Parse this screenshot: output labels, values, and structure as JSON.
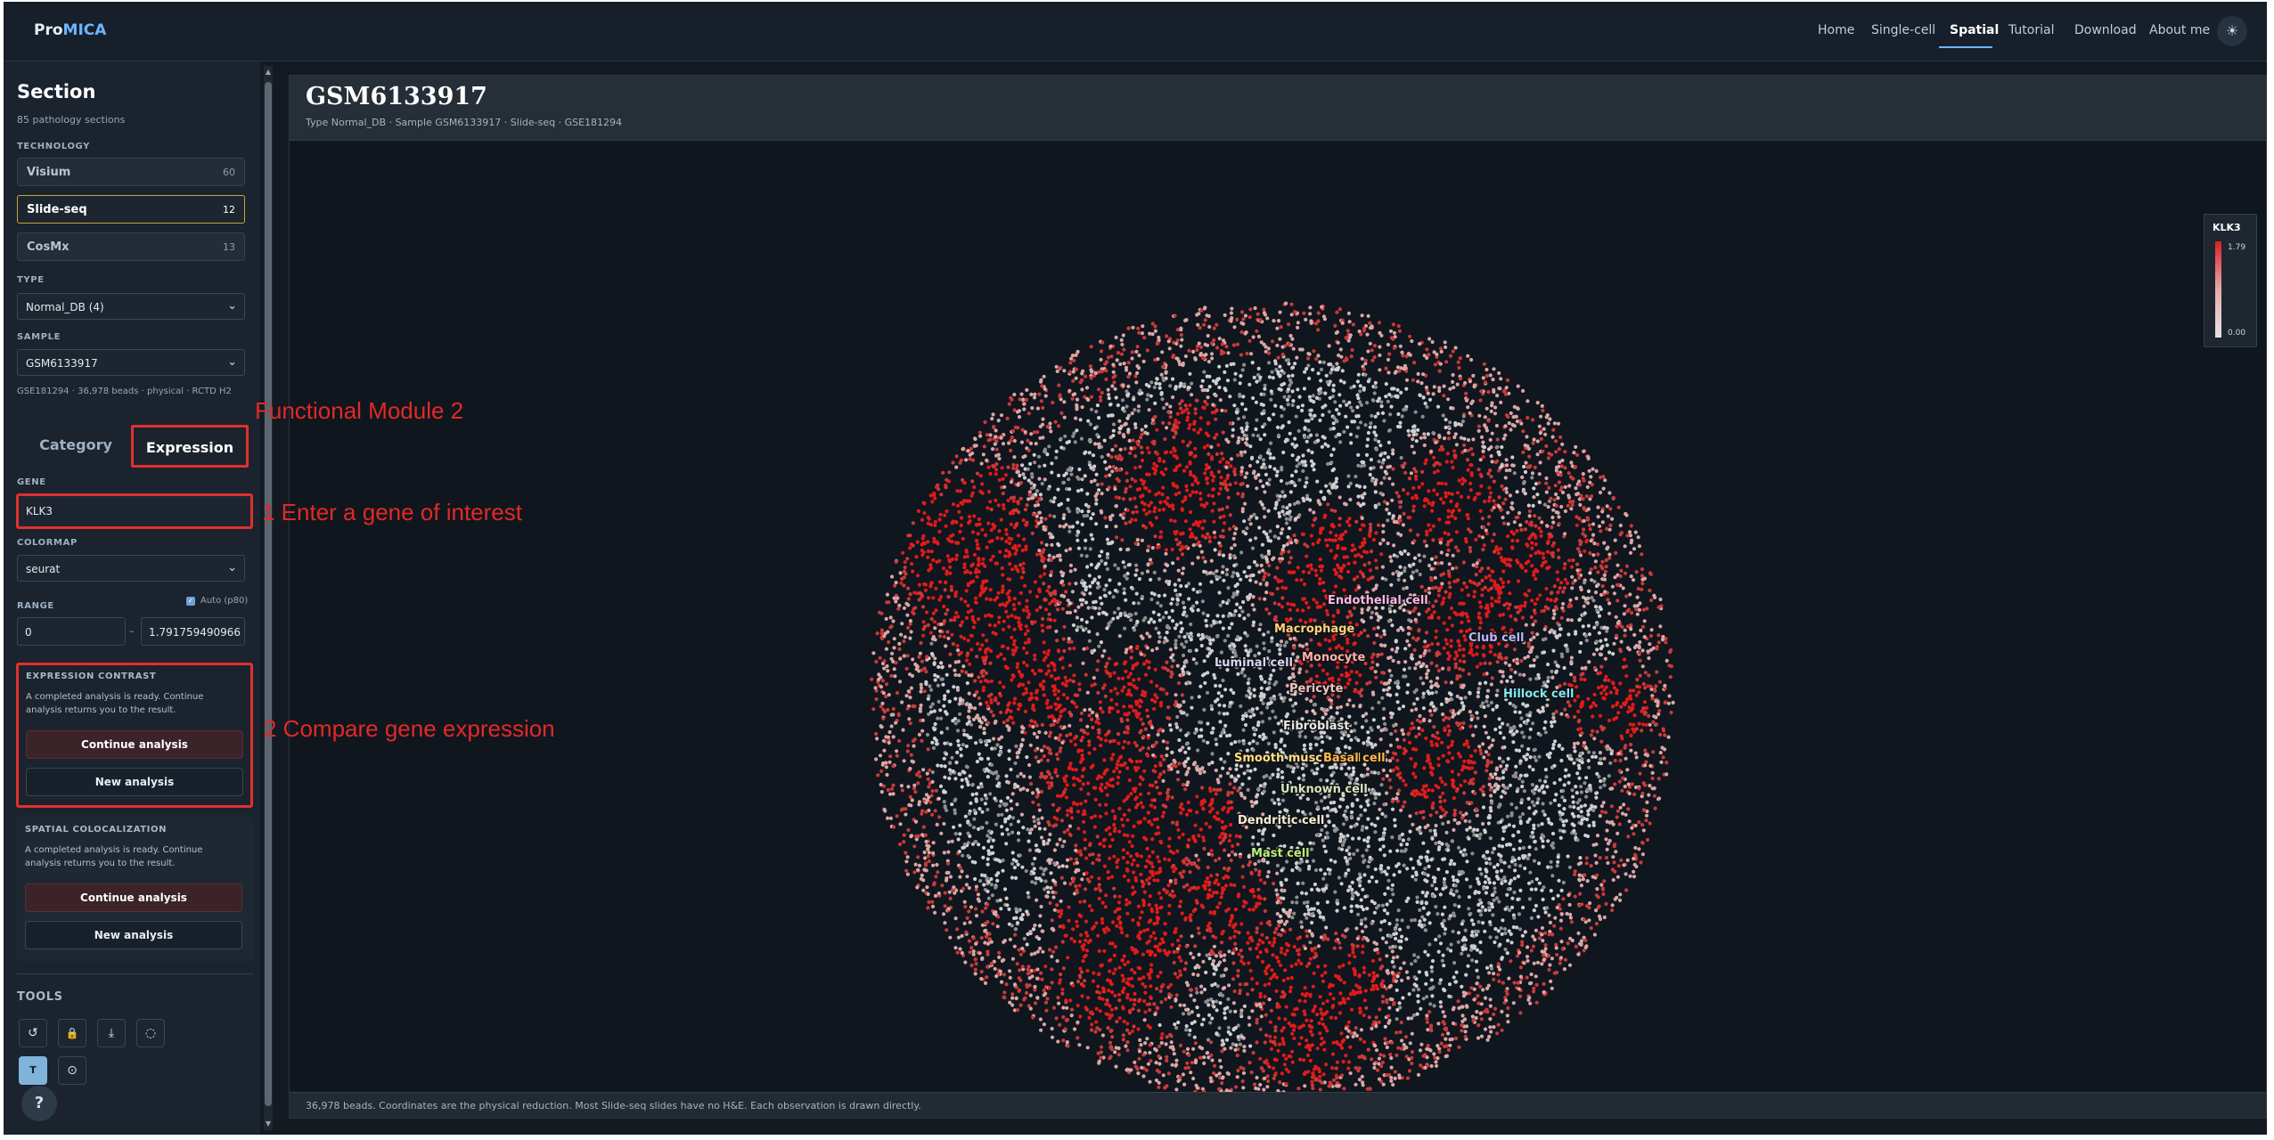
{
  "nav": {
    "brand_a": "Pro",
    "brand_b": "MICA",
    "links": [
      "Home",
      "Single-cell",
      "Spatial",
      "Tutorial",
      "Download",
      "About me"
    ],
    "active_link": "Spatial",
    "theme_icon": "sun-icon"
  },
  "sidebar": {
    "title": "Section",
    "subtitle": "85 pathology sections",
    "technology_label": "TECHNOLOGY",
    "technologies": [
      {
        "name": "Visium",
        "count": "60"
      },
      {
        "name": "Slide-seq",
        "count": "12"
      },
      {
        "name": "CosMx",
        "count": "13"
      }
    ],
    "selected_technology": "Slide-seq",
    "type_label": "TYPE",
    "type_value": "Normal_DB (4)",
    "sample_label": "SAMPLE",
    "sample_value": "GSM6133917",
    "sample_info": "GSE181294 · 36,978 beads · physical · RCTD H2",
    "tabs": {
      "category": "Category",
      "expression": "Expression"
    },
    "gene_label": "GENE",
    "gene_value": "KLK3",
    "colormap_label": "COLORMAP",
    "colormap_value": "seurat",
    "range_label": "RANGE",
    "auto_label": "Auto (p80)",
    "auto_checked": true,
    "range_min": "0",
    "range_sep": "–",
    "range_max": "1.791759490966",
    "expression_contrast": {
      "title": "EXPRESSION CONTRAST",
      "desc": "A completed analysis is ready. Continue analysis returns you to the result.",
      "continue_label": "Continue analysis",
      "new_label": "New analysis"
    },
    "spatial_colocalization": {
      "title": "SPATIAL COLOCALIZATION",
      "desc": "A completed analysis is ready. Continue analysis returns you to the result.",
      "continue_label": "Continue analysis",
      "new_label": "New analysis"
    },
    "tools_label": "TOOLS",
    "tools": [
      {
        "name": "reset-icon",
        "glyph": "↺"
      },
      {
        "name": "lock-icon",
        "glyph": "🔒"
      },
      {
        "name": "download-icon",
        "glyph": "⤓"
      },
      {
        "name": "lasso-icon",
        "glyph": "◌"
      },
      {
        "name": "text-toggle-icon",
        "glyph": "T"
      },
      {
        "name": "target-icon",
        "glyph": "⊙"
      }
    ],
    "help_label": "?"
  },
  "main": {
    "title": "GSM6133917",
    "subtitle": "Type Normal_DB · Sample GSM6133917 · Slide-seq · GSE181294",
    "footer": "36,978 beads. Coordinates are the physical reduction. Most Slide-seq slides have no H&E. Each observation is drawn directly.",
    "legend": {
      "gene": "KLK3",
      "max": "1.79",
      "min": "0.00"
    },
    "cell_labels": [
      {
        "text": "Endothelial cell",
        "color": "#f7b8e8"
      },
      {
        "text": "Macrophage",
        "color": "#ffd27a"
      },
      {
        "text": "Club cell",
        "color": "#b6b7ff"
      },
      {
        "text": "Luminal cell",
        "color": "#d8d8ff"
      },
      {
        "text": "Monocyte",
        "color": "#ffb0b0"
      },
      {
        "text": "Pericyte",
        "color": "#f2c4c4"
      },
      {
        "text": "Hillock cell",
        "color": "#7fe8f2"
      },
      {
        "text": "Fibroblast",
        "color": "#e8e8e8"
      },
      {
        "text": "Smooth muscle cell",
        "color": "#ffe08a"
      },
      {
        "text": "Basal cell",
        "color": "#ffb84a"
      },
      {
        "text": "Unknown cell",
        "color": "#d4e6c0"
      },
      {
        "text": "Dendritic cell",
        "color": "#f5f0d8"
      },
      {
        "text": "Mast cell",
        "color": "#b9f07a"
      }
    ]
  },
  "annotations": {
    "module": "Functional Module 2",
    "step1": "1 Enter a gene of interest",
    "step2": "2 Compare gene expression"
  }
}
